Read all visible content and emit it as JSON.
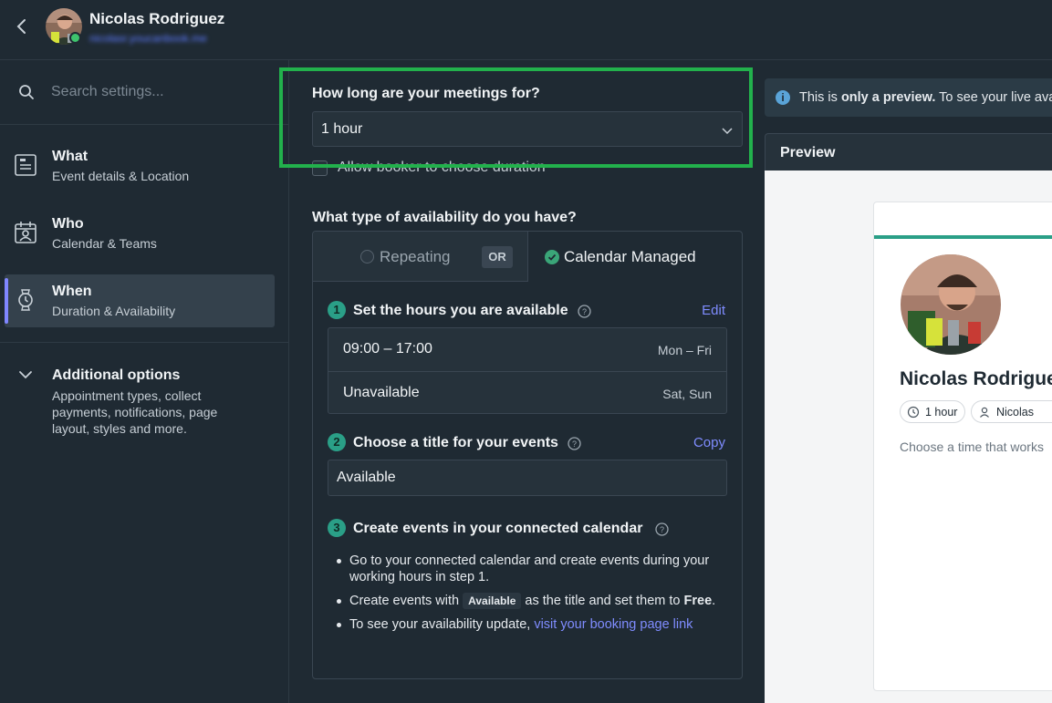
{
  "header": {
    "user_name": "Nicolas Rodriguez",
    "user_email": "nicolasr.youcanbook.me"
  },
  "sidebar": {
    "search_placeholder": "Search settings...",
    "items": [
      {
        "title": "What",
        "subtitle": "Event details & Location",
        "icon": "id-card-icon"
      },
      {
        "title": "Who",
        "subtitle": "Calendar & Teams",
        "icon": "calendar-person-icon"
      },
      {
        "title": "When",
        "subtitle": "Duration & Availability",
        "icon": "watch-icon",
        "active": true
      }
    ],
    "additional": {
      "title": "Additional options",
      "description": "Appointment types, collect payments, notifications, page layout, styles and more."
    }
  },
  "main": {
    "duration_question": "How long are your meetings for?",
    "duration_value": "1 hour",
    "allow_booker_label": "Allow booker to choose duration",
    "availability_question": "What type of availability do you have?",
    "availability_options": {
      "repeating": "Repeating",
      "or": "OR",
      "calendar_managed": "Calendar Managed"
    },
    "step1": {
      "num": "1",
      "title": "Set the hours you are available",
      "action": "Edit"
    },
    "hours": [
      {
        "time": "09:00 – 17:00",
        "days": "Mon – Fri"
      },
      {
        "time": "Unavailable",
        "days": "Sat, Sun"
      }
    ],
    "step2": {
      "num": "2",
      "title": "Choose a title for your events",
      "action": "Copy",
      "value": "Available"
    },
    "step3": {
      "num": "3",
      "title": "Create events in your connected calendar"
    },
    "bullets": {
      "b1": "Go to your connected calendar and create events during your working hours in step 1.",
      "b2_pre": "Create events with",
      "b2_code": "Available",
      "b2_post": "as the title and set them to",
      "b2_bold": "Free",
      "b2_end": ".",
      "b3_pre": "To see your availability update,",
      "b3_link": "visit your booking page link"
    }
  },
  "preview": {
    "info_pre": "This is",
    "info_bold": "only a preview.",
    "info_post": "To see your live ava",
    "title": "Preview",
    "card_name": "Nicolas Rodrigue",
    "chip_duration": "1 hour",
    "chip_person": "Nicolas",
    "choose_text": "Choose a time that works"
  },
  "colors": {
    "accent": "#7f86ff",
    "teal": "#2a9f87",
    "highlight": "#22b14c",
    "link": "#7f8cff"
  }
}
